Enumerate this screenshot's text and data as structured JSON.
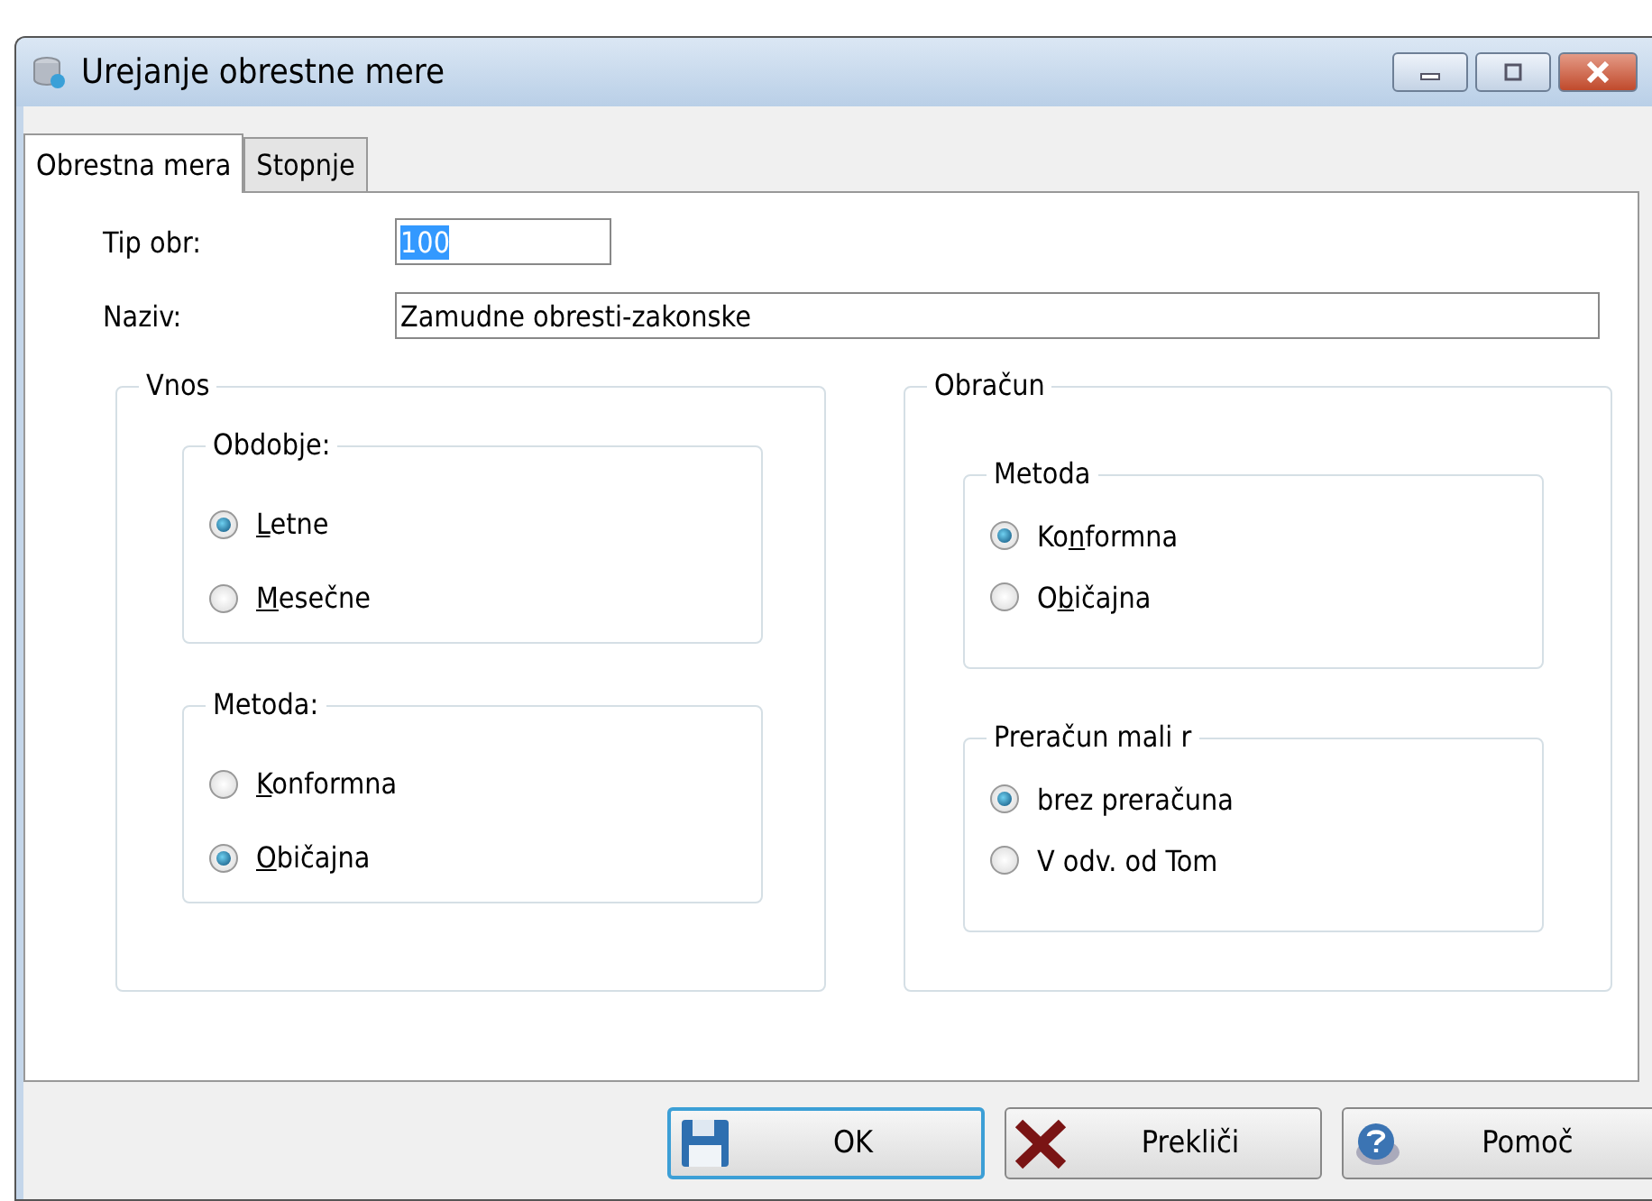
{
  "window": {
    "title": "Urejanje obrestne mere"
  },
  "tabs": [
    {
      "label": "Obrestna mera",
      "selected": true
    },
    {
      "label": "Stopnje",
      "selected": false
    }
  ],
  "fields": [
    {
      "label": "Tip obr:",
      "value": "100",
      "selected_text": true
    },
    {
      "label": "Naziv:",
      "value": "Zamudne obresti-zakonske",
      "selected_text": false
    }
  ],
  "groups": [
    {
      "title": "Vnos",
      "subgroups": [
        {
          "title": "Obdobje:",
          "options": [
            {
              "access_key": "L",
              "label_rest": "etne",
              "selected": true
            },
            {
              "access_key": "M",
              "label_rest": "esečne",
              "selected": false
            }
          ]
        },
        {
          "title": "Metoda:",
          "options": [
            {
              "access_key": "K",
              "label_rest": "onformna",
              "selected": false
            },
            {
              "access_key": "O",
              "label_rest": "bičajna",
              "selected": true
            }
          ]
        }
      ]
    },
    {
      "title": "Obračun",
      "subgroups": [
        {
          "title": "Metoda",
          "options": [
            {
              "label_start": "Ko",
              "access_key": "n",
              "label_rest": "formna",
              "selected": true
            },
            {
              "label_start": "O",
              "access_key": "b",
              "label_rest": "ičajna",
              "selected": false
            }
          ]
        },
        {
          "title": "Preračun mali r",
          "options": [
            {
              "label_start": "brez preračuna",
              "selected": true
            },
            {
              "label_start": "V odv. od Tom",
              "selected": false
            }
          ]
        }
      ]
    }
  ],
  "buttons": [
    {
      "label": "OK",
      "kind": "save",
      "focused": true
    },
    {
      "label": "Prekliči",
      "kind": "cancel",
      "focused": false
    },
    {
      "label": "Pomoč",
      "kind": "help",
      "focused": false
    }
  ]
}
